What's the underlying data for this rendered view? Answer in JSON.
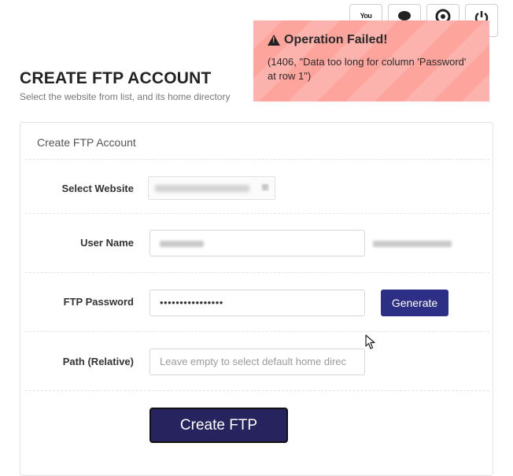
{
  "top_icons": {
    "youtube_label": "You",
    "icons": [
      "youtube-icon",
      "chat-icon",
      "support-icon",
      "power-icon"
    ]
  },
  "page": {
    "title": "CREATE FTP ACCOUNT",
    "subtitle": "Select the website from list, and its home directory"
  },
  "card": {
    "heading": "Create FTP Account"
  },
  "form": {
    "website_label": "Select Website",
    "username_label": "User Name",
    "password_label": "FTP Password",
    "password_value": "••••••••••••••••",
    "path_label": "Path (Relative)",
    "path_placeholder": "Leave empty to select default home direc",
    "generate_label": "Generate",
    "create_label": "Create FTP"
  },
  "notification": {
    "title": "Operation Failed!",
    "message": "(1406, \"Data too long for column 'Password' at row 1\")"
  },
  "colors": {
    "primary": "#2d2f86",
    "create_button": "#26235f",
    "error_bg": "#fda59d"
  }
}
